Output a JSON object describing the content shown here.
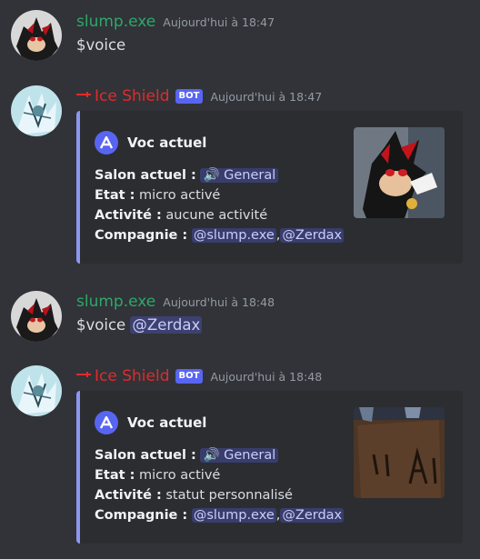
{
  "messages": [
    {
      "author": "slump.exe",
      "timestamp": "Aujourd'hui à 18:47",
      "content": "$voice"
    },
    {
      "author": "Ice Shield",
      "bot_tag": "BOT",
      "timestamp": "Aujourd'hui à 18:47",
      "embed": {
        "author_name": "Voc actuel",
        "rows": [
          {
            "label": "Salon actuel :",
            "channel": "General"
          },
          {
            "label": "Etat :",
            "value": "micro activé"
          },
          {
            "label": "Activité :",
            "value": "aucune activité"
          },
          {
            "label": "Compagnie :",
            "mention1": "@slump.exe",
            "sep": ",",
            "mention2": "@Zerdax"
          }
        ]
      }
    },
    {
      "author": "slump.exe",
      "timestamp": "Aujourd'hui à 18:48",
      "content": "$voice",
      "mention": "@Zerdax"
    },
    {
      "author": "Ice Shield",
      "bot_tag": "BOT",
      "timestamp": "Aujourd'hui à 18:48",
      "embed": {
        "author_name": "Voc actuel",
        "rows": [
          {
            "label": "Salon actuel :",
            "channel": "General"
          },
          {
            "label": "Etat :",
            "value": "micro activé"
          },
          {
            "label": "Activité :",
            "value": "statut personnalisé"
          },
          {
            "label": "Compagnie :",
            "mention1": "@slump.exe",
            "sep": ",",
            "mention2": "@Zerdax"
          }
        ]
      }
    }
  ],
  "icons": {
    "bot_prefix": "sword-icon",
    "channel": "speaker-icon",
    "embed_author": "logo-a-icon"
  },
  "colors": {
    "background": "#313338",
    "embed_bg": "#2b2d31",
    "embed_border": "#8c97f2",
    "user_name": "#2ea86a",
    "bot_name": "#e02b2b",
    "blurple": "#5865f2"
  }
}
